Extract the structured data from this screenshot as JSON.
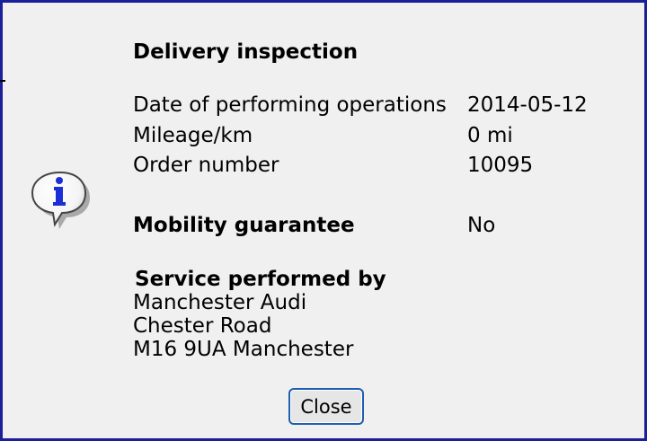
{
  "dialog": {
    "title": "Delivery inspection",
    "details": [
      {
        "label": "Date of performing operations",
        "value": "2014-05-12"
      },
      {
        "label": "Mileage/km",
        "value": "0 mi"
      },
      {
        "label": "Order number",
        "value": "10095"
      }
    ],
    "mobility": {
      "label": "Mobility guarantee",
      "value": "No"
    },
    "service": {
      "heading": "Service performed by",
      "lines": [
        "Manchester Audi",
        "Chester Road",
        "M16 9UA Manchester"
      ]
    },
    "close_label": "Close"
  },
  "icon": "info-icon",
  "colors": {
    "border": "#1b1f9a",
    "background": "#f0f0f0",
    "button_border": "#1f5fb0",
    "icon_letter": "#1a2fd6"
  }
}
